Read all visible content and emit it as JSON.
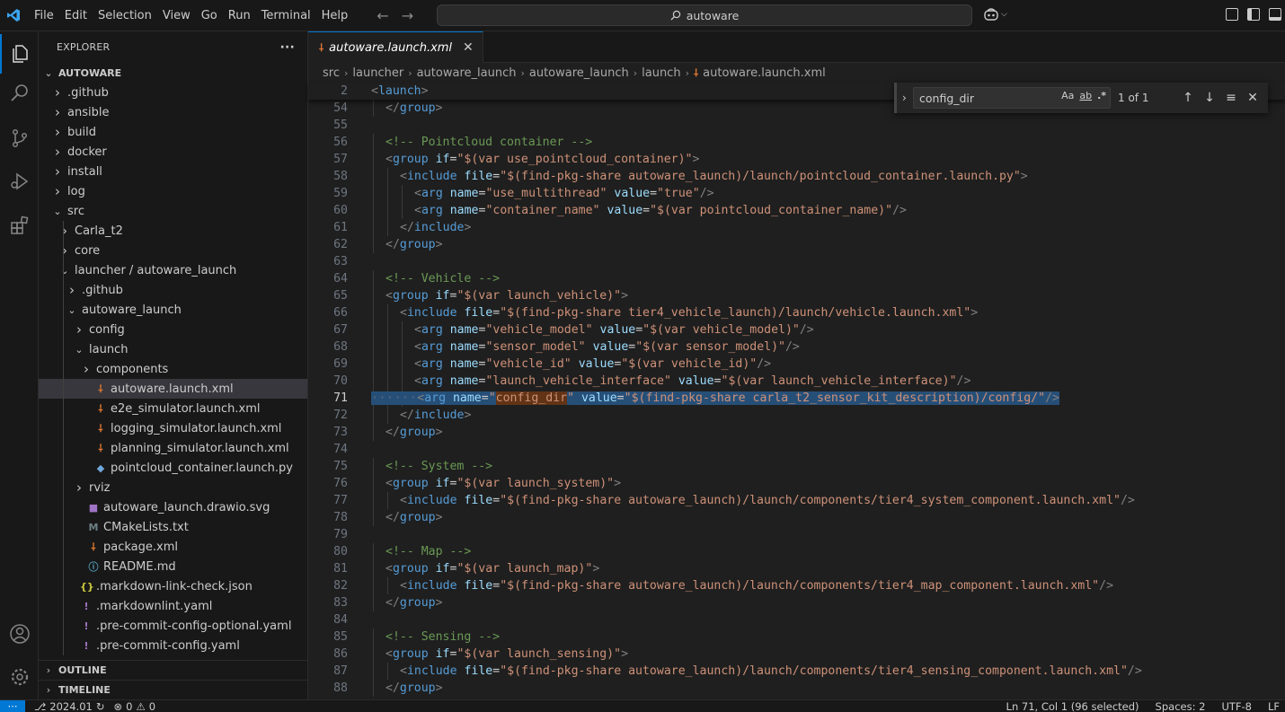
{
  "titlebar": {
    "menu": [
      "File",
      "Edit",
      "Selection",
      "View",
      "Go",
      "Run",
      "Terminal",
      "Help"
    ],
    "search_text": "autoware"
  },
  "activity_bar": [
    "explorer-icon",
    "search-icon",
    "source-control-icon",
    "run-debug-icon",
    "extensions-icon",
    "accounts-icon",
    "settings-gear-icon"
  ],
  "sidebar": {
    "title": "EXPLORER",
    "more": "···",
    "root": "AUTOWARE",
    "tree": [
      {
        "label": ".github",
        "kind": "folder",
        "depth": 0,
        "open": false
      },
      {
        "label": "ansible",
        "kind": "folder",
        "depth": 0,
        "open": false
      },
      {
        "label": "build",
        "kind": "folder",
        "depth": 0,
        "open": false
      },
      {
        "label": "docker",
        "kind": "folder",
        "depth": 0,
        "open": false
      },
      {
        "label": "install",
        "kind": "folder",
        "depth": 0,
        "open": false
      },
      {
        "label": "log",
        "kind": "folder",
        "depth": 0,
        "open": false
      },
      {
        "label": "src",
        "kind": "folder",
        "depth": 0,
        "open": true
      },
      {
        "label": "Carla_t2",
        "kind": "folder",
        "depth": 1,
        "open": false
      },
      {
        "label": "core",
        "kind": "folder",
        "depth": 1,
        "open": false
      },
      {
        "label": "launcher / autoware_launch",
        "kind": "folder",
        "depth": 1,
        "open": true
      },
      {
        "label": ".github",
        "kind": "folder",
        "depth": 2,
        "open": false
      },
      {
        "label": "autoware_launch",
        "kind": "folder",
        "depth": 2,
        "open": true
      },
      {
        "label": "config",
        "kind": "folder",
        "depth": 3,
        "open": false
      },
      {
        "label": "launch",
        "kind": "folder",
        "depth": 3,
        "open": true
      },
      {
        "label": "components",
        "kind": "folder",
        "depth": 4,
        "open": false
      },
      {
        "label": "autoware.launch.xml",
        "kind": "xml",
        "depth": 4,
        "selected": true
      },
      {
        "label": "e2e_simulator.launch.xml",
        "kind": "xml",
        "depth": 4
      },
      {
        "label": "logging_simulator.launch.xml",
        "kind": "xml",
        "depth": 4
      },
      {
        "label": "planning_simulator.launch.xml",
        "kind": "xml",
        "depth": 4
      },
      {
        "label": "pointcloud_container.launch.py",
        "kind": "py",
        "depth": 4
      },
      {
        "label": "rviz",
        "kind": "folder",
        "depth": 3,
        "open": false
      },
      {
        "label": "autoware_launch.drawio.svg",
        "kind": "svg",
        "depth": 3
      },
      {
        "label": "CMakeLists.txt",
        "kind": "cmake",
        "depth": 3
      },
      {
        "label": "package.xml",
        "kind": "xml",
        "depth": 3
      },
      {
        "label": "README.md",
        "kind": "info",
        "depth": 3
      },
      {
        "label": ".markdown-link-check.json",
        "kind": "json",
        "depth": 2
      },
      {
        "label": ".markdownlint.yaml",
        "kind": "yaml",
        "depth": 2
      },
      {
        "label": ".pre-commit-config-optional.yaml",
        "kind": "yaml",
        "depth": 2
      },
      {
        "label": ".pre-commit-config.yaml",
        "kind": "yaml",
        "depth": 2
      }
    ],
    "outline": "OUTLINE",
    "timeline": "TIMELINE"
  },
  "editor": {
    "tab_label": "autoware.launch.xml",
    "breadcrumb": [
      "src",
      "launcher",
      "autoware_launch",
      "autoware_launch",
      "launch",
      "autoware.launch.xml"
    ],
    "sticky": {
      "num": "2",
      "text": "<launch>"
    },
    "lines": [
      {
        "n": "54",
        "indent": 1,
        "segs": [
          [
            "br",
            "</"
          ],
          [
            "tag",
            "group"
          ],
          [
            "br",
            ">"
          ]
        ]
      },
      {
        "n": "55",
        "indent": 0,
        "segs": []
      },
      {
        "n": "56",
        "indent": 1,
        "segs": [
          [
            "com",
            "<!-- Pointcloud container -->"
          ]
        ]
      },
      {
        "n": "57",
        "indent": 1,
        "segs": [
          [
            "br",
            "<"
          ],
          [
            "tag",
            "group"
          ],
          [
            "txt",
            " "
          ],
          [
            "attr",
            "if"
          ],
          [
            "txt",
            "="
          ],
          [
            "str",
            "\"$(var use_pointcloud_container)\""
          ],
          [
            "br",
            ">"
          ]
        ]
      },
      {
        "n": "58",
        "indent": 2,
        "segs": [
          [
            "br",
            "<"
          ],
          [
            "tag",
            "include"
          ],
          [
            "txt",
            " "
          ],
          [
            "attr",
            "file"
          ],
          [
            "txt",
            "="
          ],
          [
            "str",
            "\"$(find-pkg-share autoware_launch)/launch/pointcloud_container.launch.py\""
          ],
          [
            "br",
            ">"
          ]
        ]
      },
      {
        "n": "59",
        "indent": 3,
        "segs": [
          [
            "br",
            "<"
          ],
          [
            "tag",
            "arg"
          ],
          [
            "txt",
            " "
          ],
          [
            "attr",
            "name"
          ],
          [
            "txt",
            "="
          ],
          [
            "str",
            "\"use_multithread\""
          ],
          [
            "txt",
            " "
          ],
          [
            "attr",
            "value"
          ],
          [
            "txt",
            "="
          ],
          [
            "str",
            "\"true\""
          ],
          [
            "br",
            "/>"
          ]
        ]
      },
      {
        "n": "60",
        "indent": 3,
        "segs": [
          [
            "br",
            "<"
          ],
          [
            "tag",
            "arg"
          ],
          [
            "txt",
            " "
          ],
          [
            "attr",
            "name"
          ],
          [
            "txt",
            "="
          ],
          [
            "str",
            "\"container_name\""
          ],
          [
            "txt",
            " "
          ],
          [
            "attr",
            "value"
          ],
          [
            "txt",
            "="
          ],
          [
            "str",
            "\"$(var pointcloud_container_name)\""
          ],
          [
            "br",
            "/>"
          ]
        ]
      },
      {
        "n": "61",
        "indent": 2,
        "segs": [
          [
            "br",
            "</"
          ],
          [
            "tag",
            "include"
          ],
          [
            "br",
            ">"
          ]
        ]
      },
      {
        "n": "62",
        "indent": 1,
        "segs": [
          [
            "br",
            "</"
          ],
          [
            "tag",
            "group"
          ],
          [
            "br",
            ">"
          ]
        ]
      },
      {
        "n": "63",
        "indent": 0,
        "segs": []
      },
      {
        "n": "64",
        "indent": 1,
        "segs": [
          [
            "com",
            "<!-- Vehicle -->"
          ]
        ]
      },
      {
        "n": "65",
        "indent": 1,
        "segs": [
          [
            "br",
            "<"
          ],
          [
            "tag",
            "group"
          ],
          [
            "txt",
            " "
          ],
          [
            "attr",
            "if"
          ],
          [
            "txt",
            "="
          ],
          [
            "str",
            "\"$(var launch_vehicle)\""
          ],
          [
            "br",
            ">"
          ]
        ]
      },
      {
        "n": "66",
        "indent": 2,
        "segs": [
          [
            "br",
            "<"
          ],
          [
            "tag",
            "include"
          ],
          [
            "txt",
            " "
          ],
          [
            "attr",
            "file"
          ],
          [
            "txt",
            "="
          ],
          [
            "str",
            "\"$(find-pkg-share tier4_vehicle_launch)/launch/vehicle.launch.xml\""
          ],
          [
            "br",
            ">"
          ]
        ]
      },
      {
        "n": "67",
        "indent": 3,
        "segs": [
          [
            "br",
            "<"
          ],
          [
            "tag",
            "arg"
          ],
          [
            "txt",
            " "
          ],
          [
            "attr",
            "name"
          ],
          [
            "txt",
            "="
          ],
          [
            "str",
            "\"vehicle_model\""
          ],
          [
            "txt",
            " "
          ],
          [
            "attr",
            "value"
          ],
          [
            "txt",
            "="
          ],
          [
            "str",
            "\"$(var vehicle_model)\""
          ],
          [
            "br",
            "/>"
          ]
        ]
      },
      {
        "n": "68",
        "indent": 3,
        "segs": [
          [
            "br",
            "<"
          ],
          [
            "tag",
            "arg"
          ],
          [
            "txt",
            " "
          ],
          [
            "attr",
            "name"
          ],
          [
            "txt",
            "="
          ],
          [
            "str",
            "\"sensor_model\""
          ],
          [
            "txt",
            " "
          ],
          [
            "attr",
            "value"
          ],
          [
            "txt",
            "="
          ],
          [
            "str",
            "\"$(var sensor_model)\""
          ],
          [
            "br",
            "/>"
          ]
        ]
      },
      {
        "n": "69",
        "indent": 3,
        "segs": [
          [
            "br",
            "<"
          ],
          [
            "tag",
            "arg"
          ],
          [
            "txt",
            " "
          ],
          [
            "attr",
            "name"
          ],
          [
            "txt",
            "="
          ],
          [
            "str",
            "\"vehicle_id\""
          ],
          [
            "txt",
            " "
          ],
          [
            "attr",
            "value"
          ],
          [
            "txt",
            "="
          ],
          [
            "str",
            "\"$(var vehicle_id)\""
          ],
          [
            "br",
            "/>"
          ]
        ]
      },
      {
        "n": "70",
        "indent": 3,
        "segs": [
          [
            "br",
            "<"
          ],
          [
            "tag",
            "arg"
          ],
          [
            "txt",
            " "
          ],
          [
            "attr",
            "name"
          ],
          [
            "txt",
            "="
          ],
          [
            "str",
            "\"launch_vehicle_interface\""
          ],
          [
            "txt",
            " "
          ],
          [
            "attr",
            "value"
          ],
          [
            "txt",
            "="
          ],
          [
            "str",
            "\"$(var launch_vehicle_interface)\""
          ],
          [
            "br",
            "/>"
          ]
        ]
      },
      {
        "n": "71",
        "indent": 3,
        "current": true,
        "segs": [
          [
            "br",
            "<"
          ],
          [
            "tag",
            "arg"
          ],
          [
            "txt",
            " "
          ],
          [
            "attr",
            "name"
          ],
          [
            "txt",
            "="
          ],
          [
            "str",
            "\""
          ],
          [
            "match",
            "config_dir"
          ],
          [
            "str",
            "\""
          ],
          [
            "txt",
            " "
          ],
          [
            "attr",
            "value"
          ],
          [
            "txt",
            "="
          ],
          [
            "str",
            "\"$(find-pkg-share carla_t2_sensor_kit_description)/config/\""
          ],
          [
            "br",
            "/>"
          ]
        ]
      },
      {
        "n": "72",
        "indent": 2,
        "segs": [
          [
            "br",
            "</"
          ],
          [
            "tag",
            "include"
          ],
          [
            "br",
            ">"
          ]
        ]
      },
      {
        "n": "73",
        "indent": 1,
        "segs": [
          [
            "br",
            "</"
          ],
          [
            "tag",
            "group"
          ],
          [
            "br",
            ">"
          ]
        ]
      },
      {
        "n": "74",
        "indent": 0,
        "segs": []
      },
      {
        "n": "75",
        "indent": 1,
        "segs": [
          [
            "com",
            "<!-- System -->"
          ]
        ]
      },
      {
        "n": "76",
        "indent": 1,
        "segs": [
          [
            "br",
            "<"
          ],
          [
            "tag",
            "group"
          ],
          [
            "txt",
            " "
          ],
          [
            "attr",
            "if"
          ],
          [
            "txt",
            "="
          ],
          [
            "str",
            "\"$(var launch_system)\""
          ],
          [
            "br",
            ">"
          ]
        ]
      },
      {
        "n": "77",
        "indent": 2,
        "segs": [
          [
            "br",
            "<"
          ],
          [
            "tag",
            "include"
          ],
          [
            "txt",
            " "
          ],
          [
            "attr",
            "file"
          ],
          [
            "txt",
            "="
          ],
          [
            "str",
            "\"$(find-pkg-share autoware_launch)/launch/components/tier4_system_component.launch.xml\""
          ],
          [
            "br",
            "/>"
          ]
        ]
      },
      {
        "n": "78",
        "indent": 1,
        "segs": [
          [
            "br",
            "</"
          ],
          [
            "tag",
            "group"
          ],
          [
            "br",
            ">"
          ]
        ]
      },
      {
        "n": "79",
        "indent": 0,
        "segs": []
      },
      {
        "n": "80",
        "indent": 1,
        "segs": [
          [
            "com",
            "<!-- Map -->"
          ]
        ]
      },
      {
        "n": "81",
        "indent": 1,
        "segs": [
          [
            "br",
            "<"
          ],
          [
            "tag",
            "group"
          ],
          [
            "txt",
            " "
          ],
          [
            "attr",
            "if"
          ],
          [
            "txt",
            "="
          ],
          [
            "str",
            "\"$(var launch_map)\""
          ],
          [
            "br",
            ">"
          ]
        ]
      },
      {
        "n": "82",
        "indent": 2,
        "segs": [
          [
            "br",
            "<"
          ],
          [
            "tag",
            "include"
          ],
          [
            "txt",
            " "
          ],
          [
            "attr",
            "file"
          ],
          [
            "txt",
            "="
          ],
          [
            "str",
            "\"$(find-pkg-share autoware_launch)/launch/components/tier4_map_component.launch.xml\""
          ],
          [
            "br",
            "/>"
          ]
        ]
      },
      {
        "n": "83",
        "indent": 1,
        "segs": [
          [
            "br",
            "</"
          ],
          [
            "tag",
            "group"
          ],
          [
            "br",
            ">"
          ]
        ]
      },
      {
        "n": "84",
        "indent": 0,
        "segs": []
      },
      {
        "n": "85",
        "indent": 1,
        "segs": [
          [
            "com",
            "<!-- Sensing -->"
          ]
        ]
      },
      {
        "n": "86",
        "indent": 1,
        "segs": [
          [
            "br",
            "<"
          ],
          [
            "tag",
            "group"
          ],
          [
            "txt",
            " "
          ],
          [
            "attr",
            "if"
          ],
          [
            "txt",
            "="
          ],
          [
            "str",
            "\"$(var launch_sensing)\""
          ],
          [
            "br",
            ">"
          ]
        ]
      },
      {
        "n": "87",
        "indent": 2,
        "segs": [
          [
            "br",
            "<"
          ],
          [
            "tag",
            "include"
          ],
          [
            "txt",
            " "
          ],
          [
            "attr",
            "file"
          ],
          [
            "txt",
            "="
          ],
          [
            "str",
            "\"$(find-pkg-share autoware_launch)/launch/components/tier4_sensing_component.launch.xml\""
          ],
          [
            "br",
            "/>"
          ]
        ]
      },
      {
        "n": "88",
        "indent": 1,
        "segs": [
          [
            "br",
            "</"
          ],
          [
            "tag",
            "group"
          ],
          [
            "br",
            ">"
          ]
        ]
      }
    ]
  },
  "find_widget": {
    "query": "config_dir",
    "match_case": "Aa",
    "whole_word": "ab",
    "regex": ".*",
    "count": "1 of 1"
  },
  "statusbar": {
    "remote_icon": "remote-icon",
    "branch": "2024.01",
    "errors": "0",
    "warnings": "0",
    "cursor": "Ln 71, Col 1 (96 selected)",
    "spaces": "Spaces: 2",
    "encoding": "UTF-8",
    "eol": "LF"
  }
}
